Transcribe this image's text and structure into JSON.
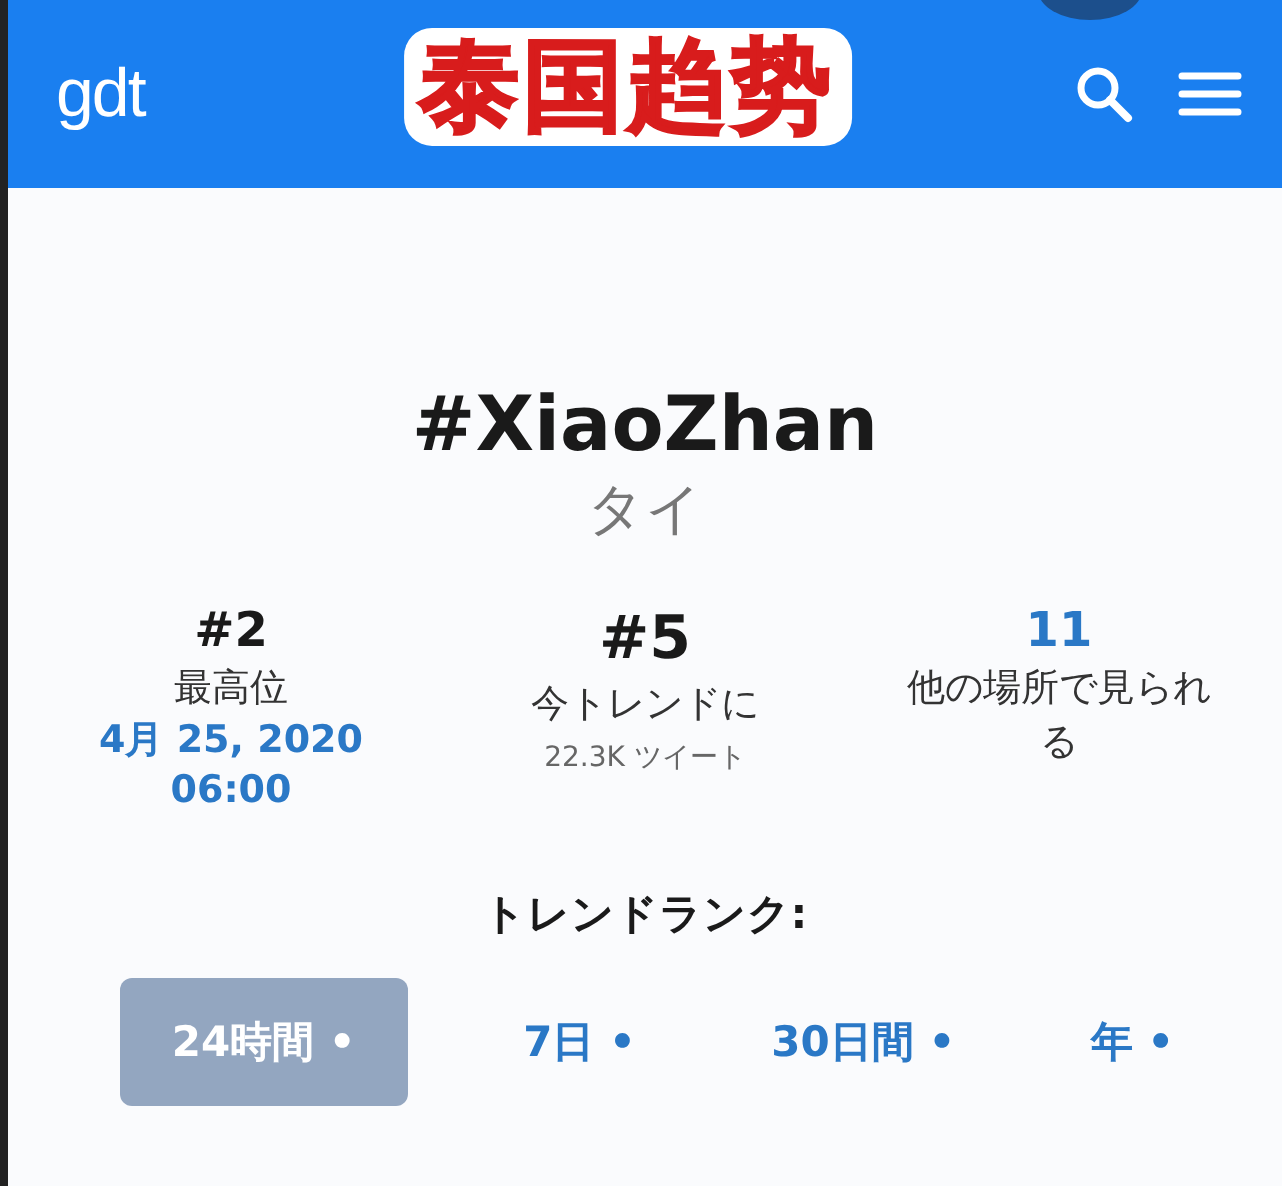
{
  "header": {
    "logo": "gdt",
    "overlay_caption": "泰国趋势"
  },
  "trend": {
    "title": "#XiaoZhan",
    "location": "タイ"
  },
  "stats": [
    {
      "kind": "plain",
      "value": "#2",
      "label": "最高位",
      "detail": "4月 25, 2020 06:00"
    },
    {
      "kind": "main",
      "value": "#5",
      "label": "今トレンドに",
      "detail": "22.3K ツイート"
    },
    {
      "kind": "link",
      "value": "11",
      "label": "他の場所で見られる"
    }
  ],
  "rank": {
    "heading": "トレンドランク:",
    "tabs": [
      {
        "label": "24時間 •",
        "selected": true
      },
      {
        "label": "7日 •",
        "selected": false
      },
      {
        "label": "30日間 •",
        "selected": false
      },
      {
        "label": "年 •",
        "selected": false
      }
    ]
  }
}
